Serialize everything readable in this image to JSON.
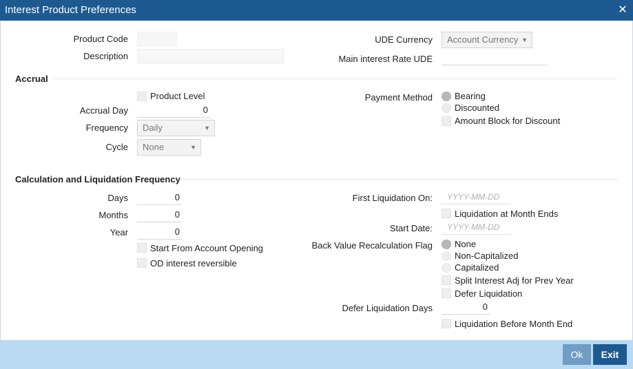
{
  "window": {
    "title": "Interest Product Preferences"
  },
  "header": {
    "product_code_label": "Product Code",
    "product_code_value": "",
    "description_label": "Description",
    "description_value": "",
    "ude_currency_label": "UDE Currency",
    "ude_currency_value": "Account Currency",
    "main_rate_label": "Main interest Rate UDE",
    "main_rate_value": ""
  },
  "accrual": {
    "section_title": "Accrual",
    "product_level_label": "Product Level",
    "accrual_day_label": "Accrual Day",
    "accrual_day_value": "0",
    "frequency_label": "Frequency",
    "frequency_value": "Daily",
    "cycle_label": "Cycle",
    "cycle_value": "None",
    "payment_method_label": "Payment Method",
    "payment_options": [
      "Bearing",
      "Discounted"
    ],
    "payment_selected": "Bearing",
    "amount_block_label": "Amount Block for Discount"
  },
  "calc": {
    "section_title": "Calculation and Liquidation Frequency",
    "days_label": "Days",
    "days_value": "0",
    "months_label": "Months",
    "months_value": "0",
    "year_label": "Year",
    "year_value": "0",
    "start_from_label": "Start From Account Opening",
    "od_reversible_label": "OD interest reversible",
    "first_liq_label": "First Liquidation On:",
    "first_liq_placeholder": "YYYY-MM-DD",
    "liq_month_end_label": "Liquidation at Month Ends",
    "start_date_label": "Start Date:",
    "start_date_placeholder": "YYYY-MM-DD",
    "back_value_label": "Back Value Recalculation Flag",
    "back_value_options": [
      "None",
      "Non-Capitalized",
      "Capitalized"
    ],
    "back_value_selected": "None",
    "split_interest_label": "Split Interest Adj for Prev Year",
    "defer_liq_label": "Defer Liquidation",
    "defer_days_label": "Defer Liquidation Days",
    "defer_days_value": "0",
    "liq_before_month_end_label": "Liquidation Before Month End"
  },
  "footer": {
    "ok_label": "Ok",
    "exit_label": "Exit"
  }
}
